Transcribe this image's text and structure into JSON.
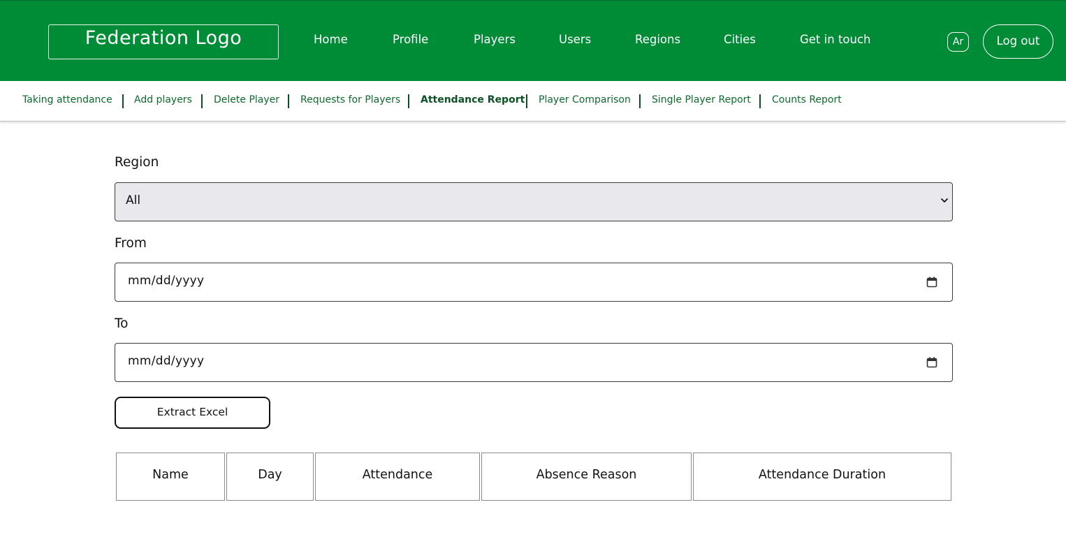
{
  "header": {
    "logo": "Federation Logo",
    "nav": [
      {
        "label": "Home"
      },
      {
        "label": "Profile"
      },
      {
        "label": "Players"
      },
      {
        "label": "Users"
      },
      {
        "label": "Regions"
      },
      {
        "label": "Cities"
      },
      {
        "label": "Get in touch"
      }
    ],
    "lang_button": "Ar",
    "logout_button": "Log out"
  },
  "subnav": {
    "items": [
      {
        "label": "Taking attendance"
      },
      {
        "label": "Add players"
      },
      {
        "label": "Delete Player"
      },
      {
        "label": "Requests for Players"
      },
      {
        "label": "Attendance Report",
        "active": true
      },
      {
        "label": "Player Comparison"
      },
      {
        "label": "Single Player Report"
      },
      {
        "label": "Counts Report"
      }
    ]
  },
  "form": {
    "region_label": "Region",
    "region_value": "All",
    "from_label": "From",
    "from_value": "mm/dd/yyyy",
    "to_label": "To",
    "to_value": "mm/dd/yyyy",
    "extract_button": "Extract Excel"
  },
  "table": {
    "columns": [
      "Name",
      "Day",
      "Attendance",
      "Absence Reason",
      "Attendance Duration"
    ]
  },
  "colors": {
    "brand_green": "#008c36",
    "subnav_text": "#0c6b2c"
  }
}
